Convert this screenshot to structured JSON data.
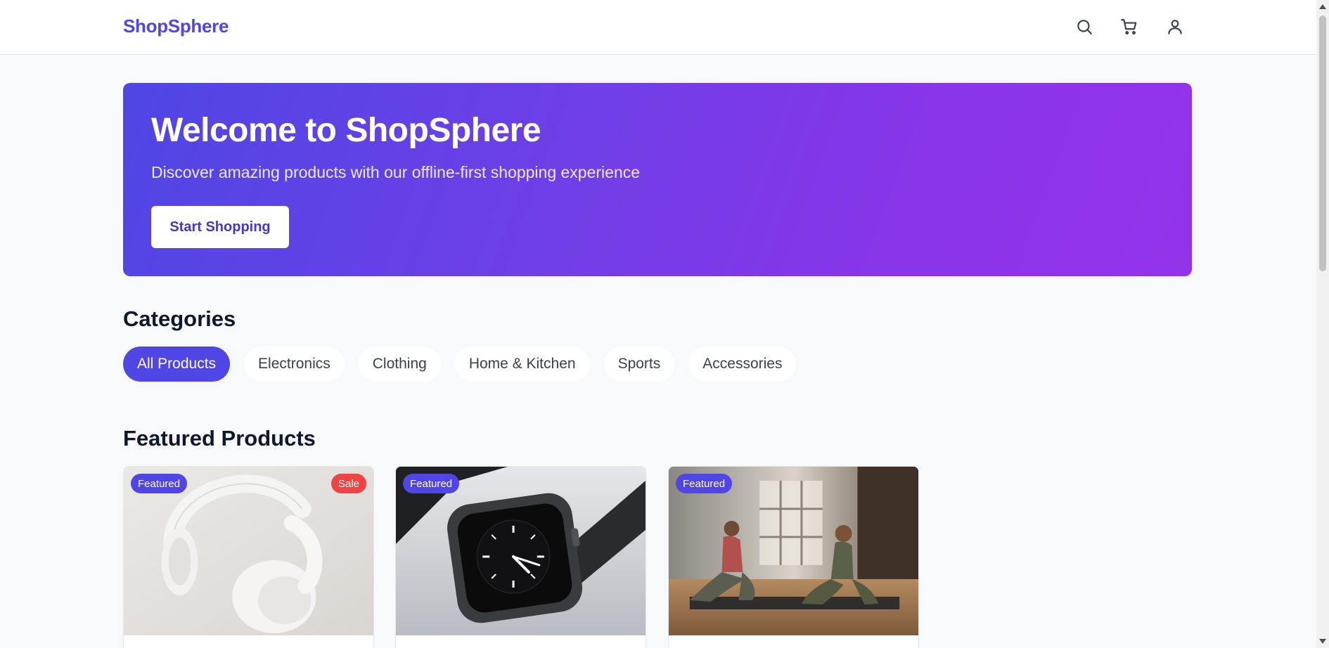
{
  "header": {
    "logo": "ShopSphere",
    "icons": [
      "search-icon",
      "cart-icon",
      "user-icon"
    ]
  },
  "hero": {
    "title": "Welcome to ShopSphere",
    "subtitle": "Discover amazing products with our offline-first shopping experience",
    "cta_label": "Start Shopping"
  },
  "categories": {
    "title": "Categories",
    "items": [
      {
        "label": "All Products",
        "active": true
      },
      {
        "label": "Electronics",
        "active": false
      },
      {
        "label": "Clothing",
        "active": false
      },
      {
        "label": "Home & Kitchen",
        "active": false
      },
      {
        "label": "Sports",
        "active": false
      },
      {
        "label": "Accessories",
        "active": false
      }
    ]
  },
  "featured": {
    "title": "Featured Products",
    "products": [
      {
        "image": "white-headphones",
        "badges": [
          "Featured",
          "Sale"
        ]
      },
      {
        "image": "smartwatch",
        "badges": [
          "Featured"
        ]
      },
      {
        "image": "yoga-class",
        "badges": [
          "Featured"
        ]
      }
    ]
  },
  "colors": {
    "brand": "#4f46e5",
    "hero_gradient_start": "#4f46e5",
    "hero_gradient_end": "#9333ea",
    "sale_badge": "#ef4444"
  }
}
